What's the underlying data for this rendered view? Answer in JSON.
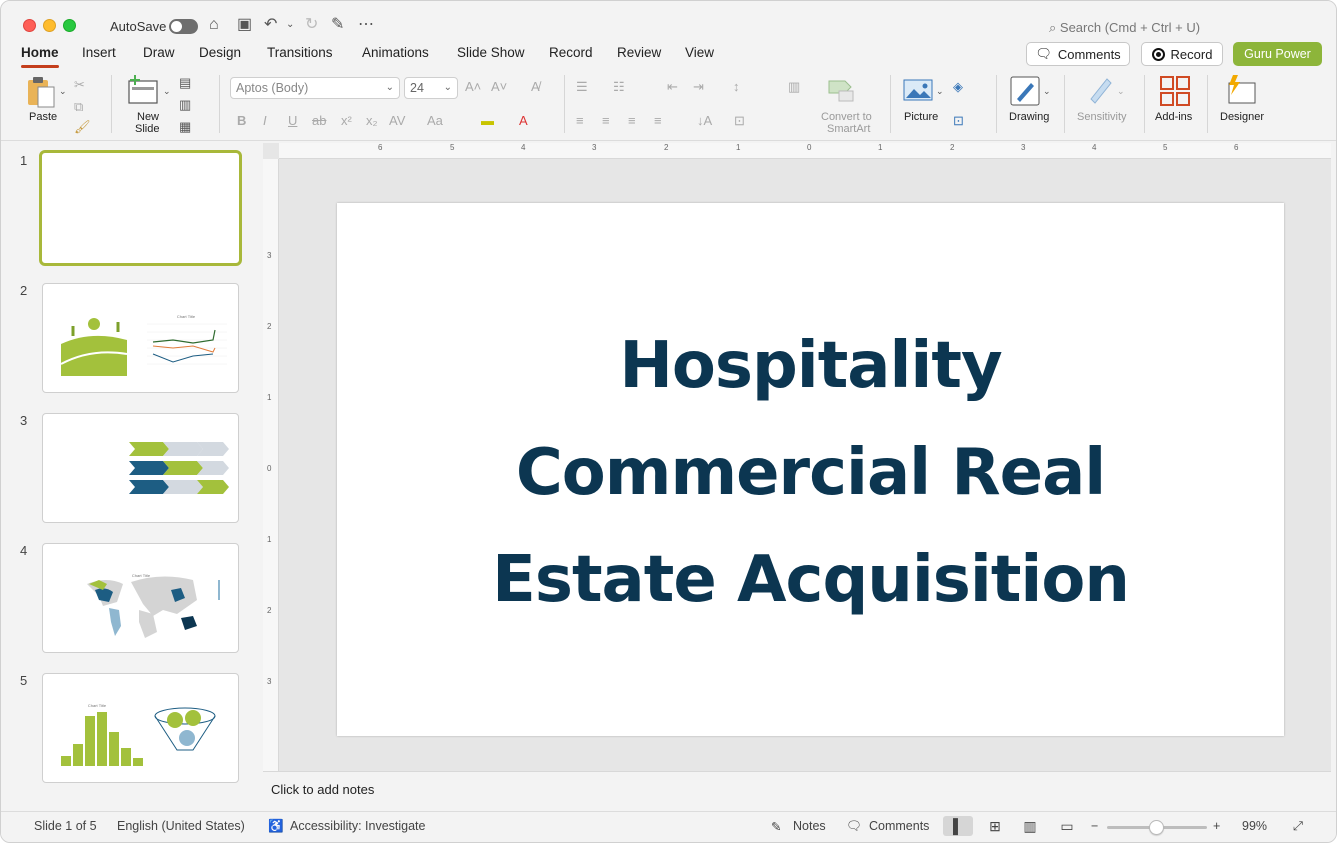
{
  "titlebar": {
    "autosave_label": "AutoSave",
    "search_placeholder": "Search (Cmd + Ctrl + U)"
  },
  "tabs": [
    {
      "label": "Home"
    },
    {
      "label": "Insert"
    },
    {
      "label": "Draw"
    },
    {
      "label": "Design"
    },
    {
      "label": "Transitions"
    },
    {
      "label": "Animations"
    },
    {
      "label": "Slide Show"
    },
    {
      "label": "Record"
    },
    {
      "label": "Review"
    },
    {
      "label": "View"
    }
  ],
  "header_buttons": {
    "comments": "Comments",
    "record": "Record",
    "guru": "Guru Power"
  },
  "ribbon": {
    "paste": "Paste",
    "new_slide_1": "New",
    "new_slide_2": "Slide",
    "font_name": "Aptos (Body)",
    "font_size": "24",
    "convert_1": "Convert to",
    "convert_2": "SmartArt",
    "picture": "Picture",
    "drawing": "Drawing",
    "sensitivity": "Sensitivity",
    "addins": "Add-ins",
    "designer": "Designer"
  },
  "slides": [
    {
      "number": "1"
    },
    {
      "number": "2",
      "chart_title": "Chart Title"
    },
    {
      "number": "3"
    },
    {
      "number": "4",
      "chart_title": "Chart Title"
    },
    {
      "number": "5",
      "chart_title": "Chart Title"
    }
  ],
  "ruler": {
    "h": [
      "6",
      "5",
      "4",
      "3",
      "2",
      "1",
      "0",
      "1",
      "2",
      "3",
      "4",
      "5",
      "6"
    ],
    "v": [
      "3",
      "2",
      "1",
      "0",
      "1",
      "2",
      "3"
    ]
  },
  "main_slide": {
    "title_line1": "Hospitality",
    "title_line2": "Commercial Real",
    "title_line3": "Estate Acquisition"
  },
  "notes_placeholder": "Click to add notes",
  "status": {
    "slide_count": "Slide 1 of 5",
    "language": "English (United States)",
    "accessibility": "Accessibility: Investigate",
    "notes": "Notes",
    "comments": "Comments",
    "zoom": "99%"
  },
  "colors": {
    "accent_green": "#8db53a",
    "title_navy": "#0c3651",
    "tab_underline": "#c43e1c"
  }
}
